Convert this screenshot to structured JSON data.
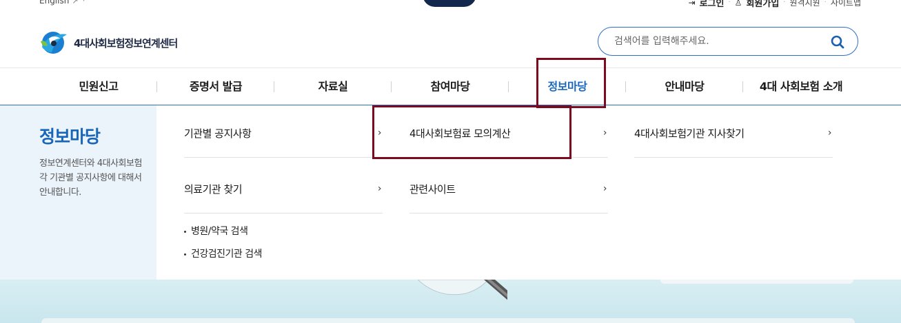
{
  "utility": {
    "language": "English",
    "links": [
      {
        "label": "로그인",
        "icon": "login-icon"
      },
      {
        "label": "회원가입",
        "icon": "user-icon"
      },
      {
        "label": "원격지원"
      },
      {
        "label": "사이트맵"
      }
    ]
  },
  "header": {
    "logo_text": "4대사회보험정보연계센터",
    "search": {
      "placeholder": "검색어를 입력해주세요."
    }
  },
  "gnb": {
    "items": [
      {
        "label": "민원신고"
      },
      {
        "label": "증명서 발급"
      },
      {
        "label": "자료실"
      },
      {
        "label": "참여마당"
      },
      {
        "label": "정보마당",
        "active": true
      },
      {
        "label": "안내마당"
      },
      {
        "label": "4대 사회보험 소개"
      }
    ]
  },
  "mega": {
    "title": "정보마당",
    "description": "정보연계센터와 4대사회보험 각 기관별 공지사항에 대해서 안내합니다.",
    "links": [
      {
        "label": "기관별 공지사항"
      },
      {
        "label": "4대사회보험료 모의계산"
      },
      {
        "label": "4대사회보험기관 지사찾기"
      },
      {
        "label": "의료기관 찾기"
      },
      {
        "label": "관련사이트"
      }
    ],
    "sub_items": [
      {
        "label": "병원/약국 검색"
      },
      {
        "label": "건강검진기관 검색"
      }
    ]
  },
  "colors": {
    "accent": "#1868c0",
    "highlight_box": "#7b0a1e",
    "side_panel": "#ebf3fb"
  }
}
